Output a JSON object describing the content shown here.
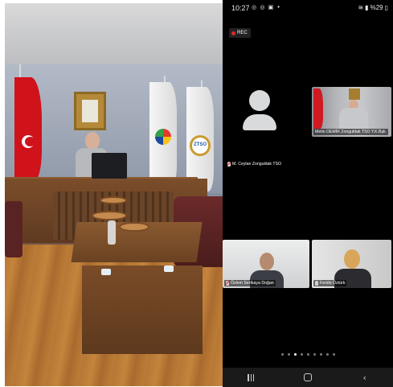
{
  "status_bar": {
    "time": "10:27",
    "left_icons": "◎ ◎ ▣ •",
    "battery": "%29"
  },
  "recording": {
    "label": "REC"
  },
  "participants": {
    "avatar_tile": {
      "name": "M. Ceylan  Zonguldak TSO"
    },
    "tile_1": {
      "name": "Metin DEMİR Zonguldak TSO Y.K.Bşk."
    },
    "tile_2": {
      "name": "Özlem Sertkaya Doğan"
    },
    "tile_3": {
      "name": "Feride Öztürk"
    }
  },
  "pager": {
    "count": 9,
    "active_index": 2
  },
  "nav": {
    "back_glyph": "‹"
  },
  "colors": {
    "rec_dot": "#e0292c",
    "screen_bg": "#000000",
    "flag_red": "#d0121b"
  },
  "icons": [
    "person-avatar-icon",
    "mic-icon",
    "wifi-icon",
    "signal-icon",
    "battery-icon",
    "recents-icon",
    "home-icon",
    "back-icon"
  ]
}
